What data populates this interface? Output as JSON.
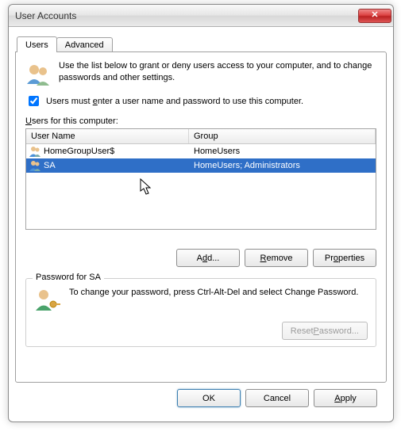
{
  "window": {
    "title": "User Accounts",
    "close_label": "Close"
  },
  "tabs": {
    "users": "Users",
    "advanced": "Advanced"
  },
  "intro": "Use the list below to grant or deny users access to your computer, and to change passwords and other settings.",
  "checkbox": {
    "pre": "Users must ",
    "e": "e",
    "post": "nter a user name and password to use this computer."
  },
  "list_label": {
    "pre": "",
    "u": "U",
    "post": "sers for this computer:"
  },
  "columns": {
    "name": "User Name",
    "group": "Group"
  },
  "rows": [
    {
      "name": "HomeGroupUser$",
      "group": "HomeUsers",
      "selected": false
    },
    {
      "name": "SA",
      "group": "HomeUsers; Administrators",
      "selected": true
    }
  ],
  "buttons": {
    "add": {
      "pre": "A",
      "u": "d",
      "post": "d..."
    },
    "remove": {
      "pre": "",
      "u": "R",
      "post": "emove"
    },
    "properties": {
      "pre": "Pr",
      "u": "o",
      "post": "perties"
    },
    "reset": {
      "pre": "Reset ",
      "u": "P",
      "post": "assword..."
    },
    "ok": "OK",
    "cancel": "Cancel",
    "apply": {
      "pre": "",
      "u": "A",
      "post": "pply"
    }
  },
  "fieldset": {
    "legend": "Password for SA",
    "text": "To change your password, press Ctrl-Alt-Del and select Change Password."
  }
}
